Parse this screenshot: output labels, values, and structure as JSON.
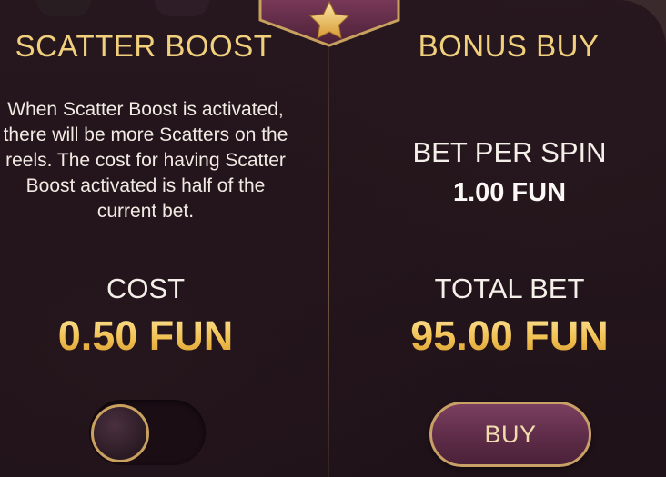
{
  "ribbon": {
    "icon": "star-icon",
    "color": "#e7c16b"
  },
  "scatter_boost": {
    "title": "SCATTER BOOST",
    "description": "When Scatter Boost is activated, there will be more Scatters on the reels. The cost for having Scatter Boost activated is half of the current bet.",
    "cost_label": "COST",
    "cost_value": "0.50 FUN",
    "toggle_on": false
  },
  "bonus_buy": {
    "title": "BONUS BUY",
    "bet_per_spin_label": "BET PER SPIN",
    "bet_per_spin_value": "1.00 FUN",
    "total_bet_label": "TOTAL BET",
    "total_bet_value": "95.00 FUN",
    "buy_label": "BUY"
  },
  "colors": {
    "gold": "#f0cf7d",
    "panel": "#24141c",
    "button": "#6b3453"
  }
}
